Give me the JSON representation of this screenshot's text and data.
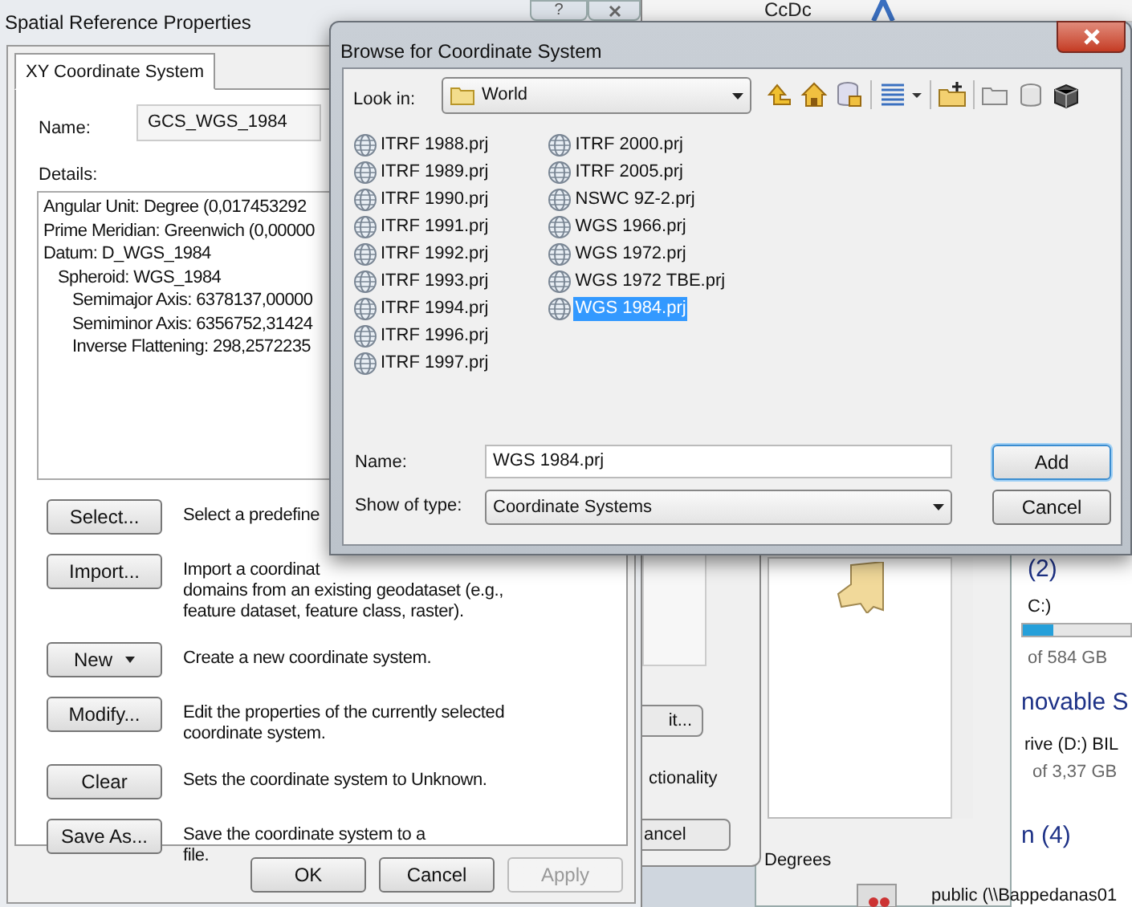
{
  "background": {
    "help_button": "?",
    "ribbon_text": "CcDc",
    "dialog_button": "it...",
    "dialog_text": "ctionality",
    "dialog_cancel": "ancel",
    "panel_status": "Degrees",
    "explorer": {
      "group_count": "(2)",
      "drive_label": "C:)",
      "drive_usage": {
        "level": 0.28
      },
      "drive_size": "of 584 GB",
      "group_title": "novable S",
      "drive2_label": "rive (D:) BIL",
      "drive2_size": "of 3,37 GB",
      "group2_title": "n (4)",
      "share_label": "public (\\\\Bappedanas01"
    }
  },
  "spatial_reference_dialog": {
    "title": "Spatial Reference Properties",
    "tabs": [
      {
        "label": "XY Coordinate System",
        "selected": true
      }
    ],
    "name_label": "Name:",
    "name_value": "GCS_WGS_1984",
    "details_label": "Details:",
    "details": [
      {
        "text": "Angular Unit: Degree (0,017453292"
      },
      {
        "text": "Prime Meridian: Greenwich (0,00000"
      },
      {
        "text": "Datum: D_WGS_1984",
        "children": [
          {
            "text": "Spheroid: WGS_1984",
            "children": [
              {
                "text": "Semimajor Axis: 6378137,00000"
              },
              {
                "text": "Semiminor Axis: 6356752,31424"
              },
              {
                "text": "Inverse Flattening: 298,2572235"
              }
            ]
          }
        ]
      }
    ],
    "actions": [
      {
        "button": "Select...",
        "kind": "plain",
        "description": [
          "Select a predefine"
        ]
      },
      {
        "button": "Import...",
        "kind": "plain",
        "description": [
          "Import a coordinat",
          "domains from an existing geodataset (e.g.,",
          "feature dataset, feature class, raster)."
        ]
      },
      {
        "button": "New",
        "kind": "dropdown",
        "description": [
          "Create a new coordinate system."
        ]
      },
      {
        "button": "Modify...",
        "kind": "plain",
        "description": [
          "Edit the properties of the currently selected",
          "coordinate system."
        ]
      },
      {
        "button": "Clear",
        "kind": "plain",
        "description": [
          "Sets the coordinate system to Unknown."
        ]
      },
      {
        "button": "Save As...",
        "kind": "plain",
        "description": [
          "Save the coordinate system to a",
          "file."
        ]
      }
    ],
    "buttons": [
      {
        "label": "OK",
        "disabled": false
      },
      {
        "label": "Cancel",
        "disabled": false
      },
      {
        "label": "Apply",
        "disabled": true
      }
    ]
  },
  "browse_dialog": {
    "title": "Browse for Coordinate System",
    "look_in_label": "Look in:",
    "look_in_value": "World",
    "files": [
      {
        "name": "ITRF 1988.prj",
        "selected": false
      },
      {
        "name": "ITRF 1989.prj",
        "selected": false
      },
      {
        "name": "ITRF 1990.prj",
        "selected": false
      },
      {
        "name": "ITRF 1991.prj",
        "selected": false
      },
      {
        "name": "ITRF 1992.prj",
        "selected": false
      },
      {
        "name": "ITRF 1993.prj",
        "selected": false
      },
      {
        "name": "ITRF 1994.prj",
        "selected": false
      },
      {
        "name": "ITRF 1996.prj",
        "selected": false
      },
      {
        "name": "ITRF 1997.prj",
        "selected": false
      },
      {
        "name": "ITRF 2000.prj",
        "selected": false
      },
      {
        "name": "ITRF 2005.prj",
        "selected": false
      },
      {
        "name": "NSWC 9Z-2.prj",
        "selected": false
      },
      {
        "name": "WGS 1966.prj",
        "selected": false
      },
      {
        "name": "WGS 1972.prj",
        "selected": false
      },
      {
        "name": "WGS 1972 TBE.prj",
        "selected": false
      },
      {
        "name": "WGS 1984.prj",
        "selected": true
      }
    ],
    "name_label": "Name:",
    "name_value": "WGS 1984.prj",
    "type_label": "Show of type:",
    "type_value": "Coordinate Systems",
    "buttons": [
      {
        "label": "Add",
        "default": true
      },
      {
        "label": "Cancel",
        "default": false
      }
    ]
  }
}
